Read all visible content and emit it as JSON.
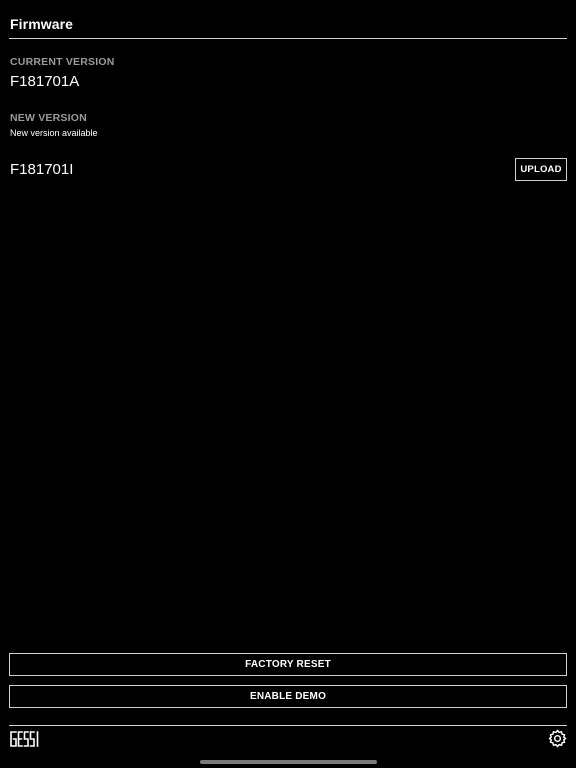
{
  "header": {
    "title": "Firmware"
  },
  "current_version": {
    "label": "CURRENT VERSION",
    "value": "F181701A"
  },
  "new_version": {
    "label": "NEW VERSION",
    "note": "New version available",
    "value": "F181701I",
    "upload_label": "UPLOAD"
  },
  "actions": {
    "factory_reset_label": "FACTORY RESET",
    "enable_demo_label": "ENABLE DEMO"
  },
  "footer": {
    "logo_text": "GESSI",
    "settings_icon": "gear-icon"
  },
  "colors": {
    "background": "#000000",
    "text": "#ffffff",
    "label_gray": "#9a9a9a",
    "border": "#cfcfcf"
  }
}
